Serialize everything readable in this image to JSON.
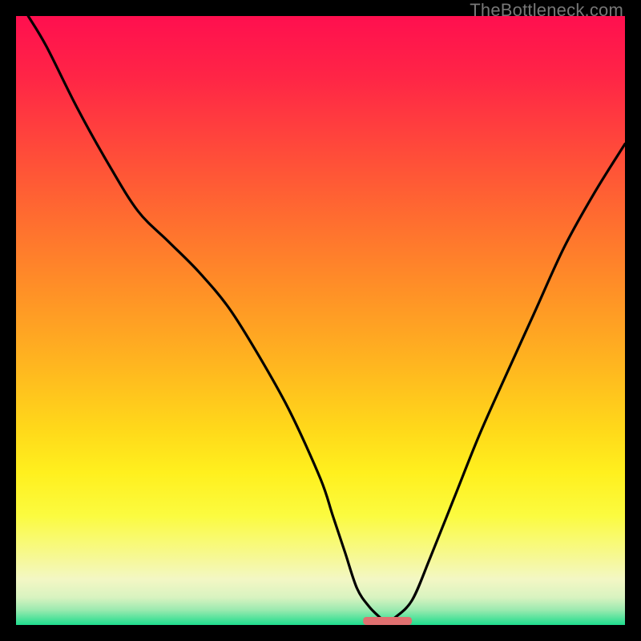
{
  "watermark": "TheBottleneck.com",
  "chart_data": {
    "type": "line",
    "title": "",
    "xlabel": "",
    "ylabel": "",
    "xlim": [
      0,
      100
    ],
    "ylim": [
      0,
      100
    ],
    "grid": false,
    "legend": false,
    "series": [
      {
        "name": "curve",
        "x": [
          2,
          5,
          10,
          15,
          20,
          25,
          30,
          35,
          40,
          45,
          50,
          52,
          54,
          56,
          58,
          60,
          61,
          62,
          65,
          68,
          72,
          76,
          80,
          85,
          90,
          95,
          100
        ],
        "values": [
          100,
          95,
          85,
          76,
          68,
          63,
          58,
          52,
          44,
          35,
          24,
          18,
          12,
          6,
          3,
          1,
          0,
          1,
          4,
          11,
          21,
          31,
          40,
          51,
          62,
          71,
          79
        ]
      }
    ],
    "marker": {
      "name": "optimal-marker",
      "x_start": 57,
      "x_end": 65,
      "y": 0,
      "color": "#e07070"
    },
    "background_gradient": {
      "stops": [
        {
          "offset": 0.0,
          "color": "#ff0f4f"
        },
        {
          "offset": 0.1,
          "color": "#ff2546"
        },
        {
          "offset": 0.22,
          "color": "#ff4a3a"
        },
        {
          "offset": 0.34,
          "color": "#ff6f2f"
        },
        {
          "offset": 0.46,
          "color": "#ff9326"
        },
        {
          "offset": 0.58,
          "color": "#ffb81f"
        },
        {
          "offset": 0.68,
          "color": "#ffd91a"
        },
        {
          "offset": 0.75,
          "color": "#fff01e"
        },
        {
          "offset": 0.82,
          "color": "#fbfb3f"
        },
        {
          "offset": 0.88,
          "color": "#f7f989"
        },
        {
          "offset": 0.925,
          "color": "#f3f7c4"
        },
        {
          "offset": 0.955,
          "color": "#d8f3c0"
        },
        {
          "offset": 0.975,
          "color": "#9ceab0"
        },
        {
          "offset": 0.99,
          "color": "#4fe29a"
        },
        {
          "offset": 1.0,
          "color": "#1fdc8e"
        }
      ]
    }
  }
}
